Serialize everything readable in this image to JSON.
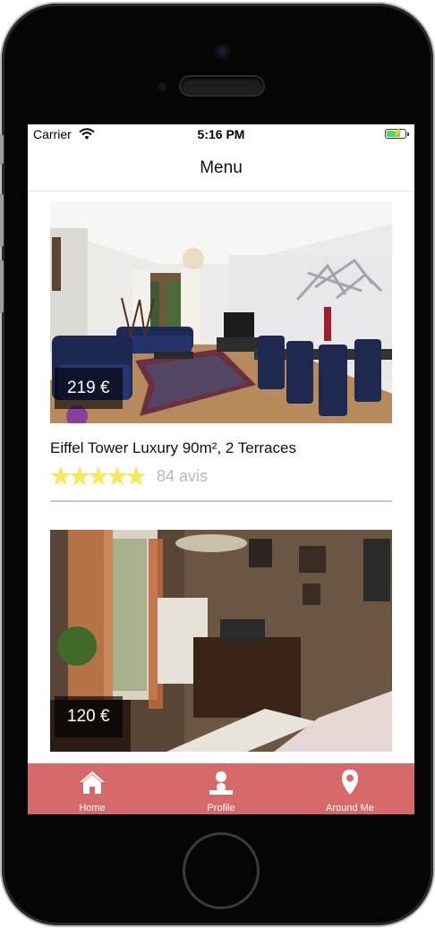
{
  "status_bar": {
    "carrier": "Carrier",
    "time": "5:16 PM"
  },
  "nav": {
    "title": "Menu"
  },
  "listings": [
    {
      "price": "219 €",
      "title": "Eiffel Tower Luxury 90m², 2 Terraces",
      "rating": 5,
      "reviews": "84 avis"
    },
    {
      "price": "120 €"
    }
  ],
  "tabs": [
    {
      "label": "Home",
      "icon": "home-icon"
    },
    {
      "label": "Profile",
      "icon": "profile-icon"
    },
    {
      "label": "Around Me",
      "icon": "location-pin-icon"
    }
  ],
  "colors": {
    "tab_bar": "#d66a6a",
    "star": "#f7ea5a",
    "battery": "#4cd964"
  }
}
